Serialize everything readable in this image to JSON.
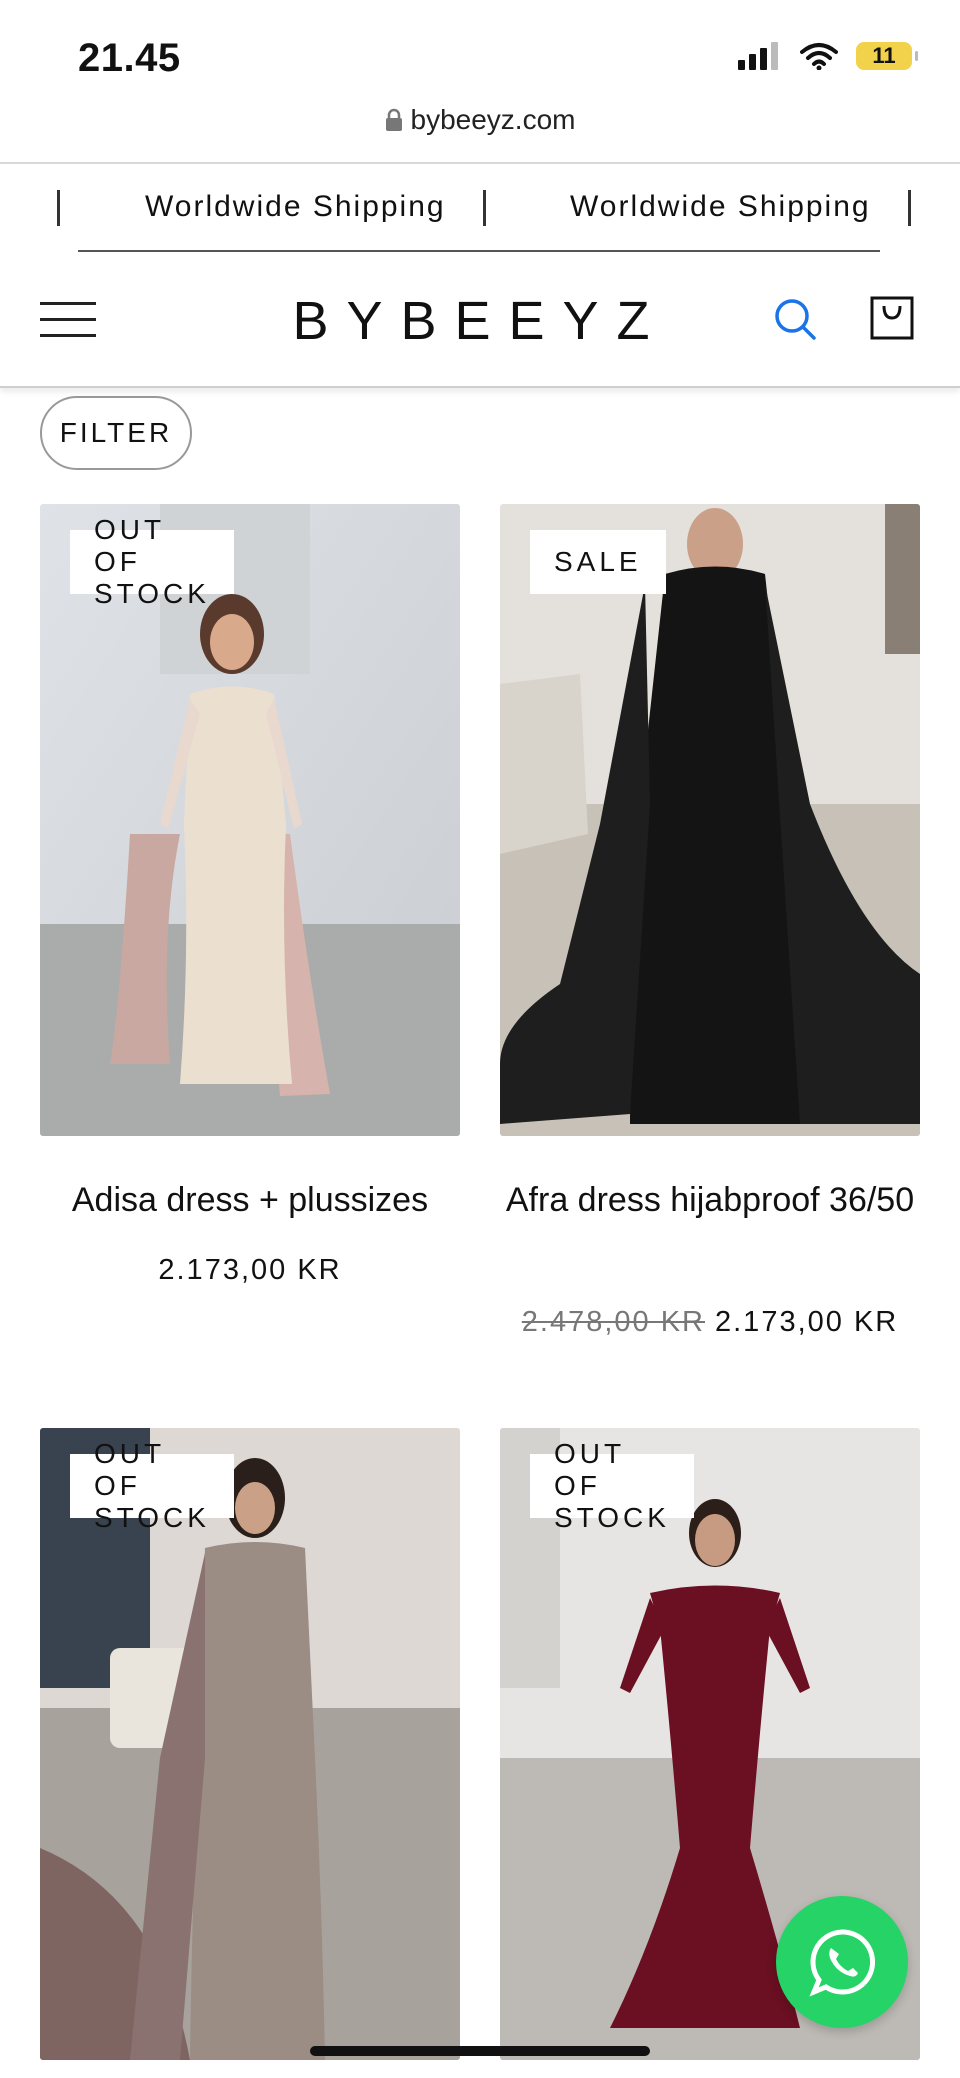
{
  "status_bar": {
    "time": "21.45",
    "battery": "11"
  },
  "browser": {
    "url": "bybeeyz.com"
  },
  "announcement": {
    "items": [
      "Worldwide Shipping",
      "Worldwide Shipping"
    ]
  },
  "header": {
    "logo": "BYBEEYZ"
  },
  "filter": {
    "label": "FILTER"
  },
  "products": [
    {
      "badge": "OUT OF STOCK",
      "title": "Adisa dress + plussizes",
      "price": "2.173,00 KR",
      "old_price": ""
    },
    {
      "badge": "SALE",
      "title": "Afra dress hijabproof 36/50",
      "price": "2.173,00 KR",
      "old_price": "2.478,00 KR"
    },
    {
      "badge": "OUT OF STOCK"
    },
    {
      "badge": "OUT OF STOCK"
    }
  ],
  "colors": {
    "accent_search": "#1a73e8",
    "whatsapp": "#25d366"
  }
}
